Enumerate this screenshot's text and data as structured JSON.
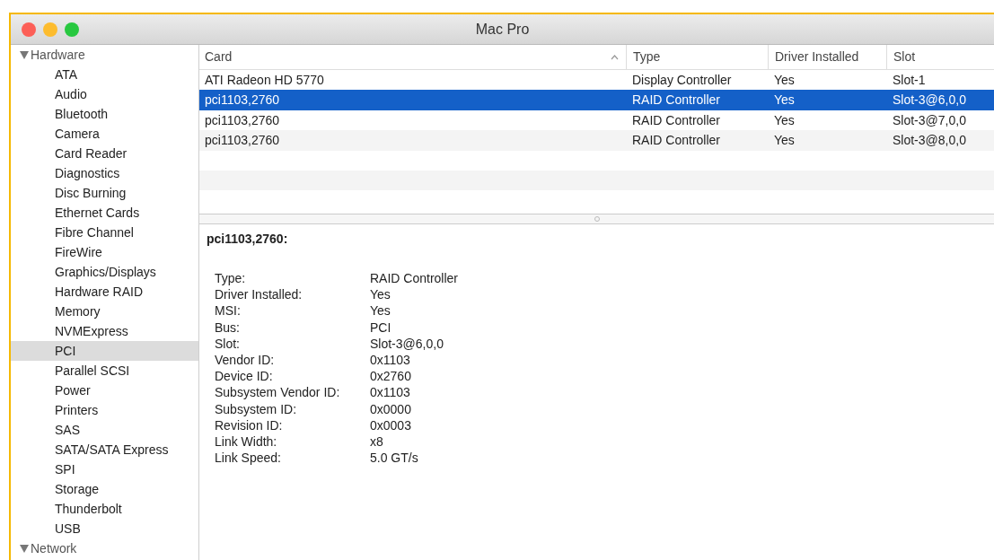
{
  "window": {
    "title": "Mac Pro"
  },
  "sidebar": {
    "items": [
      {
        "label": "Hardware",
        "expanded": true,
        "selected": false,
        "children": [
          {
            "label": "ATA",
            "selected": false
          },
          {
            "label": "Audio",
            "selected": false
          },
          {
            "label": "Bluetooth",
            "selected": false
          },
          {
            "label": "Camera",
            "selected": false
          },
          {
            "label": "Card Reader",
            "selected": false
          },
          {
            "label": "Diagnostics",
            "selected": false
          },
          {
            "label": "Disc Burning",
            "selected": false
          },
          {
            "label": "Ethernet Cards",
            "selected": false
          },
          {
            "label": "Fibre Channel",
            "selected": false
          },
          {
            "label": "FireWire",
            "selected": false
          },
          {
            "label": "Graphics/Displays",
            "selected": false
          },
          {
            "label": "Hardware RAID",
            "selected": false
          },
          {
            "label": "Memory",
            "selected": false
          },
          {
            "label": "NVMExpress",
            "selected": false
          },
          {
            "label": "PCI",
            "selected": true
          },
          {
            "label": "Parallel SCSI",
            "selected": false
          },
          {
            "label": "Power",
            "selected": false
          },
          {
            "label": "Printers",
            "selected": false
          },
          {
            "label": "SAS",
            "selected": false
          },
          {
            "label": "SATA/SATA Express",
            "selected": false
          },
          {
            "label": "SPI",
            "selected": false
          },
          {
            "label": "Storage",
            "selected": false
          },
          {
            "label": "Thunderbolt",
            "selected": false
          },
          {
            "label": "USB",
            "selected": false
          }
        ]
      },
      {
        "label": "Network",
        "expanded": true,
        "selected": false
      }
    ]
  },
  "table": {
    "columns": [
      {
        "label": "Card",
        "sorted": true
      },
      {
        "label": "Type",
        "sorted": false
      },
      {
        "label": "Driver Installed",
        "sorted": false
      },
      {
        "label": "Slot",
        "sorted": false
      }
    ],
    "rows": [
      {
        "cells": [
          "ATI Radeon HD 5770",
          "Display Controller",
          "Yes",
          "Slot-1"
        ],
        "selected": false
      },
      {
        "cells": [
          "pci1103,2760",
          "RAID Controller",
          "Yes",
          "Slot-3@6,0,0"
        ],
        "selected": true
      },
      {
        "cells": [
          "pci1103,2760",
          "RAID Controller",
          "Yes",
          "Slot-3@7,0,0"
        ],
        "selected": false
      },
      {
        "cells": [
          "pci1103,2760",
          "RAID Controller",
          "Yes",
          "Slot-3@8,0,0"
        ],
        "selected": false
      }
    ]
  },
  "details": {
    "title": "pci1103,2760:",
    "fields": [
      {
        "key": "Type:",
        "value": "RAID Controller"
      },
      {
        "key": "Driver Installed:",
        "value": "Yes"
      },
      {
        "key": "MSI:",
        "value": "Yes"
      },
      {
        "key": "Bus:",
        "value": "PCI"
      },
      {
        "key": "Slot:",
        "value": "Slot-3@6,0,0"
      },
      {
        "key": "Vendor ID:",
        "value": "0x1103"
      },
      {
        "key": "Device ID:",
        "value": "0x2760"
      },
      {
        "key": "Subsystem Vendor ID:",
        "value": "0x1103"
      },
      {
        "key": "Subsystem ID:",
        "value": "0x0000"
      },
      {
        "key": "Revision ID:",
        "value": "0x0003"
      },
      {
        "key": "Link Width:",
        "value": "x8"
      },
      {
        "key": "Link Speed:",
        "value": "5.0 GT/s"
      }
    ]
  }
}
